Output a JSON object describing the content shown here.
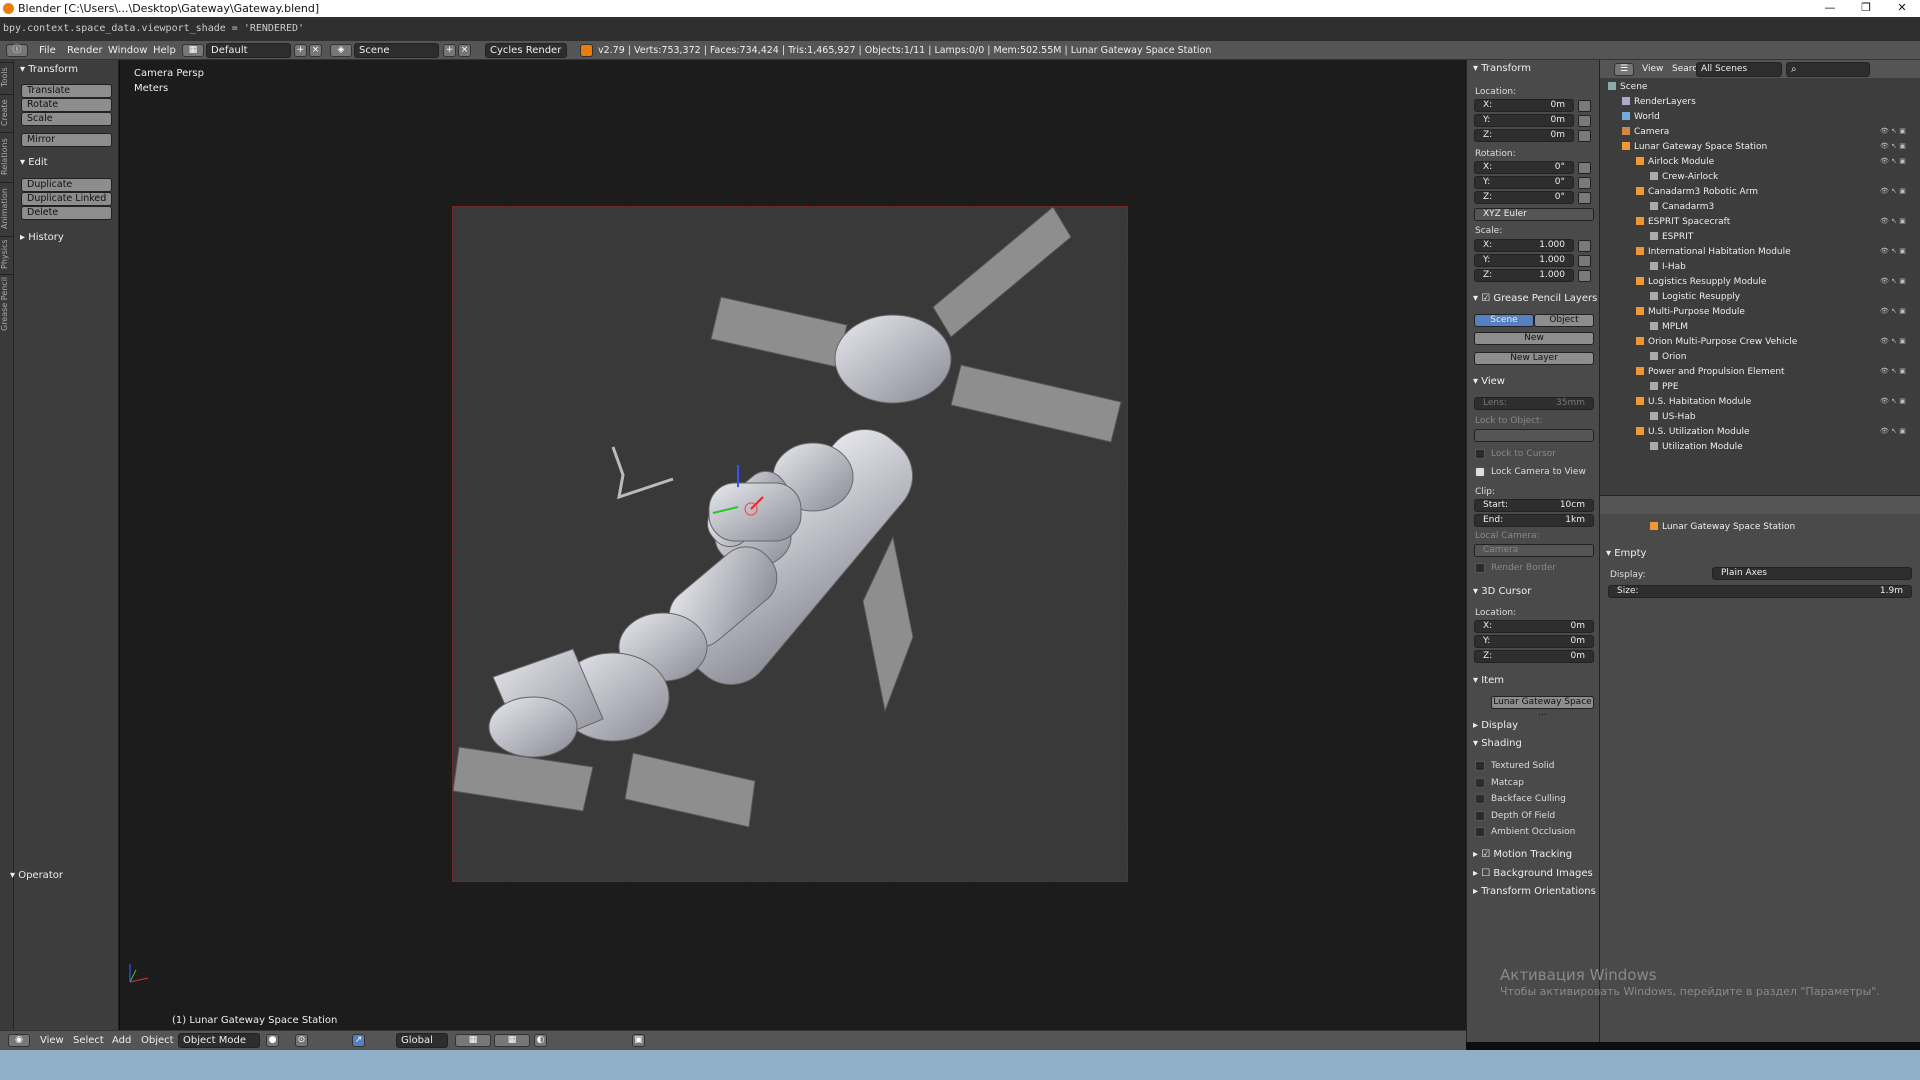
{
  "window": {
    "title_prefix": "Blender",
    "title_path": "[C:\\Users\\...\\Desktop\\Gateway\\Gateway.blend]"
  },
  "info": {
    "python": "bpy.context.space_data.viewport_shade = 'RENDERED'"
  },
  "header": {
    "menus": [
      "File",
      "Render",
      "Window",
      "Help"
    ],
    "layout": "Default",
    "scene": "Scene",
    "engine": "Cycles Render",
    "stats": "v2.79 | Verts:753,372 | Faces:734,424 | Tris:1,465,927 | Objects:1/11 | Lamps:0/0 | Mem:502.55M | Lunar Gateway Space Station"
  },
  "toolshelf": {
    "tabs": [
      "Tools",
      "Create",
      "Relations",
      "Animation",
      "Physics",
      "Grease Pencil"
    ],
    "transform_title": "Transform",
    "transform": [
      "Translate",
      "Rotate",
      "Scale"
    ],
    "mirror": "Mirror",
    "edit_title": "Edit",
    "edit": [
      "Duplicate",
      "Duplicate Linked",
      "Delete"
    ],
    "history": "History",
    "operator": "Operator"
  },
  "viewport": {
    "mode_label": "Camera Persp",
    "units": "Meters",
    "selected": "(1) Lunar Gateway Space Station"
  },
  "properties": {
    "transform": "Transform",
    "location": "Location:",
    "rotation": "Rotation:",
    "scale": "Scale:",
    "loc": [
      {
        "k": "X:",
        "v": "0m"
      },
      {
        "k": "Y:",
        "v": "0m"
      },
      {
        "k": "Z:",
        "v": "0m"
      }
    ],
    "rot": [
      {
        "k": "X:",
        "v": "0°"
      },
      {
        "k": "Y:",
        "v": "0°"
      },
      {
        "k": "Z:",
        "v": "0°"
      }
    ],
    "rot_mode": "XYZ Euler",
    "scl": [
      {
        "k": "X:",
        "v": "1.000"
      },
      {
        "k": "Y:",
        "v": "1.000"
      },
      {
        "k": "Z:",
        "v": "1.000"
      }
    ],
    "grease": "Grease Pencil Layers",
    "scene_btn": "Scene",
    "object_btn": "Object",
    "new_btn": "New",
    "new_layer": "New Layer",
    "view": "View",
    "lens": "Lens:",
    "lens_val": "35mm",
    "lock_obj": "Lock to Object:",
    "lock_cursor": "Lock to Cursor",
    "lock_cam": "Lock Camera to View",
    "clip": "Clip:",
    "clip_start": "Start:",
    "clip_start_v": "10cm",
    "clip_end": "End:",
    "clip_end_v": "1km",
    "local_cam": "Local Camera:",
    "camera": "Camera",
    "render_border": "Render Border",
    "cursor": "3D Cursor",
    "cursor_loc": "Location:",
    "cur": [
      {
        "k": "X:",
        "v": "0m"
      },
      {
        "k": "Y:",
        "v": "0m"
      },
      {
        "k": "Z:",
        "v": "0m"
      }
    ],
    "item": "Item",
    "item_name": "Lunar Gateway Space ...",
    "display": "Display",
    "shading": "Shading",
    "shading_opts": [
      "Textured Solid",
      "Matcap",
      "Backface Culling",
      "Depth Of Field",
      "Ambient Occlusion"
    ],
    "motion": "Motion Tracking",
    "bg": "Background Images",
    "orient": "Transform Orientations"
  },
  "outliner": {
    "view": "View",
    "search": "Search",
    "filter": "All Scenes",
    "rows": [
      {
        "t": "Scene",
        "d": 0,
        "c": "#8aa"
      },
      {
        "t": "RenderLayers",
        "d": 1,
        "c": "#aac"
      },
      {
        "t": "World",
        "d": 1,
        "c": "#7ad"
      },
      {
        "t": "Camera",
        "d": 1,
        "c": "#c84"
      },
      {
        "t": "Lunar Gateway Space Station",
        "d": 1,
        "c": "#e93"
      },
      {
        "t": "Airlock Module",
        "d": 2,
        "c": "#e93"
      },
      {
        "t": "Crew-Airlock",
        "d": 3,
        "c": "#aaa"
      },
      {
        "t": "Canadarm3 Robotic Arm",
        "d": 2,
        "c": "#e93"
      },
      {
        "t": "Canadarm3",
        "d": 3,
        "c": "#aaa"
      },
      {
        "t": "ESPRIT Spacecraft",
        "d": 2,
        "c": "#e93"
      },
      {
        "t": "ESPRIT",
        "d": 3,
        "c": "#aaa"
      },
      {
        "t": "International Habitation Module",
        "d": 2,
        "c": "#e93"
      },
      {
        "t": "I-Hab",
        "d": 3,
        "c": "#aaa"
      },
      {
        "t": "Logistics Resupply Module",
        "d": 2,
        "c": "#e93"
      },
      {
        "t": "Logistic Resupply",
        "d": 3,
        "c": "#aaa"
      },
      {
        "t": "Multi-Purpose Module",
        "d": 2,
        "c": "#e93"
      },
      {
        "t": "MPLM",
        "d": 3,
        "c": "#aaa"
      },
      {
        "t": "Orion Multi-Purpose Crew Vehicle",
        "d": 2,
        "c": "#e93"
      },
      {
        "t": "Orion",
        "d": 3,
        "c": "#aaa"
      },
      {
        "t": "Power and Propulsion Element",
        "d": 2,
        "c": "#e93"
      },
      {
        "t": "PPE",
        "d": 3,
        "c": "#aaa"
      },
      {
        "t": "U.S. Habitation Module",
        "d": 2,
        "c": "#e93"
      },
      {
        "t": "US-Hab",
        "d": 3,
        "c": "#aaa"
      },
      {
        "t": "U.S. Utilization Module",
        "d": 2,
        "c": "#e93"
      },
      {
        "t": "Utilization Module",
        "d": 3,
        "c": "#aaa"
      }
    ]
  },
  "prop_editor": {
    "crumb": "Lunar Gateway Space Station",
    "empty": "Empty",
    "display": "Display:",
    "display_val": "Plain Axes",
    "size": "Size:",
    "size_val": "1.9m"
  },
  "bottom": {
    "menus": [
      "View",
      "Select",
      "Add",
      "Object"
    ],
    "mode": "Object Mode",
    "orientation": "Global"
  },
  "watermark": {
    "title": "Активация Windows",
    "text": "Чтобы активировать Windows, перейдите в раздел \"Параметры\"."
  }
}
